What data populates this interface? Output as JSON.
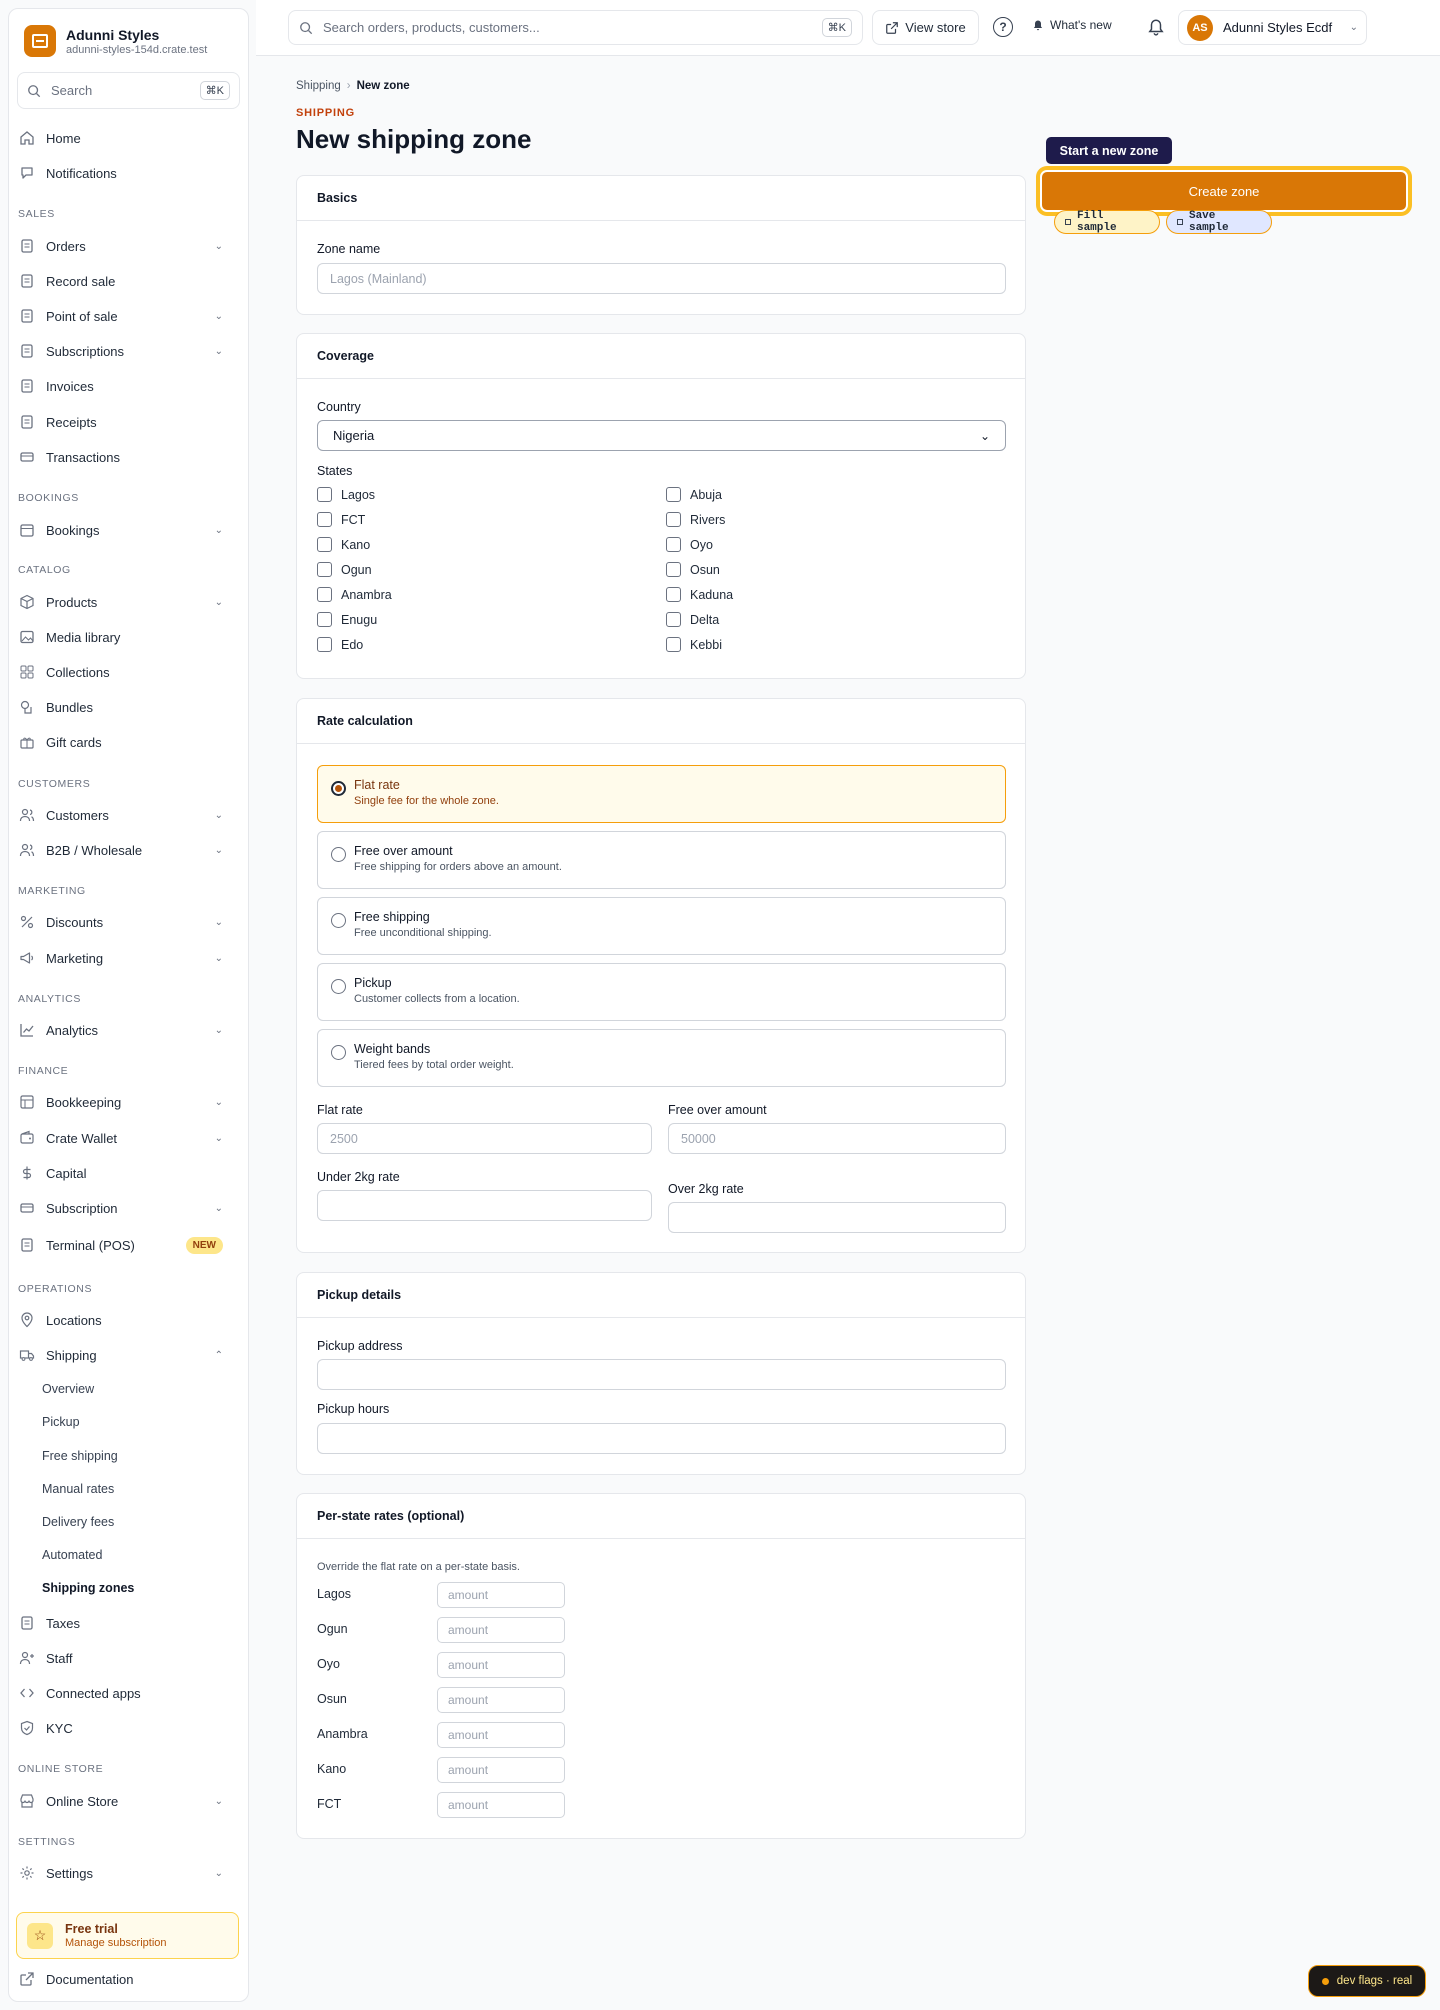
{
  "brand": {
    "name": "Adunni Styles",
    "domain": "adunni-styles-154d.crate.test"
  },
  "sidebar": {
    "search_placeholder": "Search",
    "search_kbd": "⌘K",
    "items": {
      "home": "Home",
      "notifications": "Notifications",
      "orders": "Orders",
      "record_sale": "Record sale",
      "pos": "Point of sale",
      "subscriptions": "Subscriptions",
      "invoices": "Invoices",
      "receipts": "Receipts",
      "transactions": "Transactions",
      "bookings": "Bookings",
      "products": "Products",
      "media": "Media library",
      "collections": "Collections",
      "bundles": "Bundles",
      "gift_cards": "Gift cards",
      "customers": "Customers",
      "b2b": "B2B / Wholesale",
      "discounts": "Discounts",
      "marketing": "Marketing",
      "analytics": "Analytics",
      "bookkeeping": "Bookkeeping",
      "wallet": "Crate Wallet",
      "capital": "Capital",
      "subscription": "Subscription",
      "terminal": "Terminal (POS)",
      "locations": "Locations",
      "shipping": "Shipping",
      "taxes": "Taxes",
      "staff": "Staff",
      "connected_apps": "Connected apps",
      "kyc": "KYC",
      "online_store": "Online Store",
      "settings": "Settings",
      "documentation": "Documentation"
    },
    "badge_new": "NEW",
    "sections": {
      "sales": "SALES",
      "bookings": "BOOKINGS",
      "catalog": "CATALOG",
      "customers": "CUSTOMERS",
      "marketing": "MARKETING",
      "analytics": "ANALYTICS",
      "finance": "FINANCE",
      "operations": "OPERATIONS",
      "online_store": "ONLINE STORE",
      "settings": "SETTINGS"
    },
    "shipping_sub": [
      "Overview",
      "Pickup",
      "Free shipping",
      "Manual rates",
      "Delivery fees",
      "Automated",
      "Shipping zones"
    ],
    "trial": {
      "title": "Free trial",
      "sub": "Manage subscription"
    }
  },
  "topbar": {
    "search_placeholder": "Search orders, products, customers...",
    "search_kbd": "⌘K",
    "view_store": "View store",
    "help": "?",
    "whats_new": "What's new",
    "account": "Adunni Styles Ecdf",
    "avatar": "AS"
  },
  "breadcrumb": {
    "parent": "Shipping",
    "sep": "›",
    "current": "New zone"
  },
  "eyebrow": "SHIPPING",
  "page_title": "New shipping zone",
  "basics": {
    "title": "Basics",
    "zone_label": "Zone name",
    "zone_placeholder": "Lagos (Mainland)"
  },
  "coverage": {
    "title": "Coverage",
    "country_label": "Country",
    "country_value": "Nigeria",
    "states_label": "States",
    "states_left": [
      "Lagos",
      "FCT",
      "Kano",
      "Ogun",
      "Anambra",
      "Enugu",
      "Edo"
    ],
    "states_right": [
      "Abuja",
      "Rivers",
      "Oyo",
      "Osun",
      "Kaduna",
      "Delta",
      "Kebbi"
    ]
  },
  "rate": {
    "title": "Rate calculation",
    "options": [
      {
        "title": "Flat rate",
        "desc": "Single fee for the whole zone."
      },
      {
        "title": "Free over amount",
        "desc": "Free shipping for orders above an amount."
      },
      {
        "title": "Free shipping",
        "desc": "Free unconditional shipping."
      },
      {
        "title": "Pickup",
        "desc": "Customer collects from a location."
      },
      {
        "title": "Weight bands",
        "desc": "Tiered fees by total order weight."
      }
    ],
    "selected": "Flat rate",
    "flat_label": "Flat rate",
    "flat_placeholder": "2500",
    "free_over_label": "Free over amount",
    "free_over_placeholder": "50000",
    "under2_label": "Under 2kg rate",
    "over2_label": "Over 2kg rate"
  },
  "pickup": {
    "title": "Pickup details",
    "address_label": "Pickup address",
    "hours_label": "Pickup hours"
  },
  "per_state": {
    "title": "Per-state rates (optional)",
    "hint": "Override the flat rate on a per-state basis.",
    "states": [
      "Lagos",
      "Ogun",
      "Oyo",
      "Osun",
      "Anambra",
      "Kano",
      "FCT"
    ],
    "placeholder": "amount"
  },
  "actions": {
    "tooltip": "Start a new zone",
    "create": "Create zone",
    "fill_sample": "Fill sample",
    "save_sample": "Save sample"
  },
  "dev_flags": "dev flags · real",
  "colors": {
    "accent": "#d97706",
    "tooltip_bg": "#1e1b4b",
    "selected_bg": "#fffbeb"
  }
}
